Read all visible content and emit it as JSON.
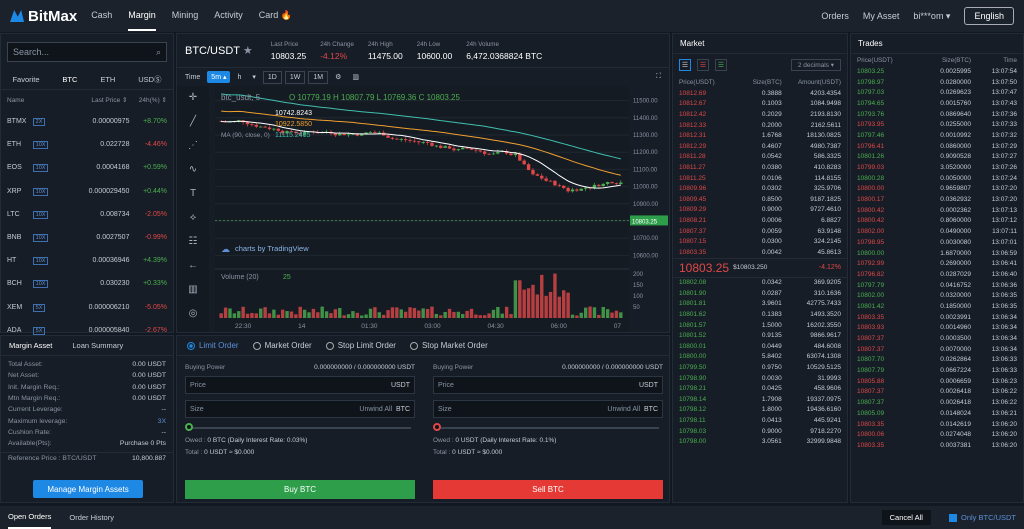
{
  "nav": {
    "brand": "BitMax",
    "links": [
      "Cash",
      "Margin",
      "Mining",
      "Activity",
      "Card"
    ],
    "orders": "Orders",
    "my_asset": "My Asset",
    "user": "bi***om ▾",
    "lang": "English"
  },
  "left": {
    "search_placeholder": "Search...",
    "tabs": [
      "Favorite",
      "BTC",
      "ETH",
      "USDⓈ"
    ],
    "head": [
      "Name",
      "Last Price ⇕",
      "24h(%) ⇕"
    ],
    "rows": [
      {
        "n": "BTMX",
        "l": "2X",
        "p": "0.00000975",
        "c": "+8.70%",
        "up": true
      },
      {
        "n": "ETH",
        "l": "10X",
        "p": "0.022728",
        "c": "-4.46%",
        "up": false
      },
      {
        "n": "EOS",
        "l": "10X",
        "p": "0.0004168",
        "c": "+0.59%",
        "up": true
      },
      {
        "n": "XRP",
        "l": "10X",
        "p": "0.000029450",
        "c": "+0.44%",
        "up": true
      },
      {
        "n": "LTC",
        "l": "10X",
        "p": "0.008734",
        "c": "-2.05%",
        "up": false
      },
      {
        "n": "BNB",
        "l": "10X",
        "p": "0.0027507",
        "c": "-0.99%",
        "up": false
      },
      {
        "n": "HT",
        "l": "10X",
        "p": "0.00036946",
        "c": "+4.39%",
        "up": true
      },
      {
        "n": "BCH",
        "l": "10X",
        "p": "0.030230",
        "c": "+0.33%",
        "up": true
      },
      {
        "n": "XEM",
        "l": "5X",
        "p": "0.000006210",
        "c": "-5.05%",
        "up": false
      },
      {
        "n": "ADA",
        "l": "5X",
        "p": "0.000005840",
        "c": "-2.67%",
        "up": false
      }
    ]
  },
  "margin": {
    "tabs": [
      "Margin Asset",
      "Loan Summary"
    ],
    "rows": [
      [
        "Total Asset:",
        "0.00 USDT"
      ],
      [
        "Net Asset:",
        "0.00 USDT"
      ],
      [
        "Init. Margin Req.:",
        "0.00 USDT"
      ],
      [
        "Mtn Margin Req.:",
        "0.00 USDT"
      ],
      [
        "Current Leverage:",
        "--"
      ],
      [
        "Maximum leverage:",
        "3X"
      ],
      [
        "Cushion Rate:",
        "--"
      ],
      [
        "Available(Pts):",
        "Purchase  0 Pts"
      ]
    ],
    "ref_label": "Reference Price : BTC/USDT",
    "ref_value": "10,800.887",
    "button": "Manage Margin Assets"
  },
  "chart": {
    "pair": "BTC/USDT",
    "stats": [
      [
        "Last Price",
        "10803.25"
      ],
      [
        "24h Change",
        "-4.12%"
      ],
      [
        "24h High",
        "11475.00"
      ],
      [
        "24h Low",
        "10600.00"
      ],
      [
        "24h Volume",
        "6,472.0368824 BTC"
      ]
    ],
    "toolbar": [
      "Time",
      "5m ▴",
      "h",
      "▾",
      "1D",
      "1W",
      "1M"
    ],
    "legend": "btc_usdt, 5",
    "ohlc": "O 10779.19  H 10807.79  L 10769.36  C 10803.25",
    "ma1": "10742.8243",
    "ma2": "10922.5850",
    "ma3": "11115.2465",
    "ma_label": "MA (90, close, 0)",
    "vol_label": "Volume (20)",
    "vol_val": "25",
    "tv": "charts by TradingView",
    "yticks": [
      "11500.00",
      "11400.00",
      "11300.00",
      "11200.00",
      "11100.00",
      "11000.00",
      "10900.00",
      "10800.00",
      "10700.00",
      "10600.00"
    ],
    "vticks": [
      "200",
      "150",
      "100",
      "50"
    ],
    "xticks": [
      "22:30",
      "14",
      "01:30",
      "03:00",
      "04:30",
      "06:00",
      "07"
    ],
    "last": "10803.25"
  },
  "form": {
    "tabs": [
      "Limit Order",
      "Market Order",
      "Stop Limit Order",
      "Stop Market Order"
    ],
    "buy": {
      "power": "0.000000000 / 0.000000000 USDT",
      "owed": "0 BTC  (Daily Interest Rate: 0.03%)",
      "total": "0 USDT ≈ $0.000",
      "btn": "Buy BTC",
      "unit": "BTC"
    },
    "sell": {
      "power": "0.000000000 / 0.000000000 USDT",
      "owed": "0 USDT  (Daily Interest Rate: 0.1%)",
      "total": "0 USDT ≈ $0.000",
      "btn": "Sell BTC",
      "unit": "BTC"
    },
    "labels": {
      "bp": "Buying Power",
      "price": "Price",
      "size": "Size",
      "unwind": "Unwind All",
      "usdt": "USDT",
      "owed": "Owed :",
      "total": "Total :"
    }
  },
  "market": {
    "title": "Market",
    "decimals": "2 decimals ▾",
    "head": [
      "Price(USDT)",
      "Size(BTC)",
      "Amount(USDT)"
    ],
    "asks": [
      [
        "10812.69",
        "0.3888",
        "4203.4354"
      ],
      [
        "10812.67",
        "0.1003",
        "1084.9498"
      ],
      [
        "10812.42",
        "0.2029",
        "2193.8130"
      ],
      [
        "10812.33",
        "0.2000",
        "2162.5611"
      ],
      [
        "10812.31",
        "1.6768",
        "18130.0825"
      ],
      [
        "10812.29",
        "0.4607",
        "4980.7387"
      ],
      [
        "10811.28",
        "0.0542",
        "586.3325"
      ],
      [
        "10811.27",
        "0.0380",
        "410.8283"
      ],
      [
        "10811.25",
        "0.0106",
        "114.8155"
      ],
      [
        "10809.96",
        "0.0302",
        "325.9706"
      ],
      [
        "10809.45",
        "0.8500",
        "9187.1825"
      ],
      [
        "10809.29",
        "0.9000",
        "9727.4610"
      ],
      [
        "10808.21",
        "0.0006",
        "6.8827"
      ],
      [
        "10807.37",
        "0.0059",
        "63.9148"
      ],
      [
        "10807.15",
        "0.0300",
        "324.2145"
      ],
      [
        "10803.35",
        "0.0042",
        "45.8613"
      ]
    ],
    "mid_price": "10803.25",
    "mid_usd": "$10803.250",
    "mid_chg": "-4.12%",
    "bids": [
      [
        "10802.08",
        "0.0342",
        "369.9205"
      ],
      [
        "10801.90",
        "0.0287",
        "310.1636"
      ],
      [
        "10801.81",
        "3.9601",
        "42775.7433"
      ],
      [
        "10801.62",
        "0.1383",
        "1493.3520"
      ],
      [
        "10801.57",
        "1.5000",
        "16202.3550"
      ],
      [
        "10801.52",
        "0.9135",
        "9866.9617"
      ],
      [
        "10800.01",
        "0.0449",
        "484.6008"
      ],
      [
        "10800.00",
        "5.8402",
        "63074.1308"
      ],
      [
        "10799.50",
        "0.9750",
        "10529.5125"
      ],
      [
        "10798.90",
        "0.0030",
        "31.9993"
      ],
      [
        "10798.21",
        "0.0425",
        "458.9606"
      ],
      [
        "10798.14",
        "1.7908",
        "19337.0975"
      ],
      [
        "10798.12",
        "1.8000",
        "19436.6160"
      ],
      [
        "10798.11",
        "0.0413",
        "445.9241"
      ],
      [
        "10798.03",
        "0.9000",
        "9718.2270"
      ],
      [
        "10798.00",
        "3.0561",
        "32999.9848"
      ]
    ]
  },
  "trades": {
    "title": "Trades",
    "head": [
      "Price(USDT)",
      "Size(BTC)",
      "Time"
    ],
    "rows": [
      [
        "10803.25",
        "0.0025995",
        "13:07:54",
        1
      ],
      [
        "10798.97",
        "0.0280000",
        "13:07:50",
        1
      ],
      [
        "10797.03",
        "0.0269623",
        "13:07:47",
        1
      ],
      [
        "10794.65",
        "0.0015760",
        "13:07:43",
        1
      ],
      [
        "10793.76",
        "0.0869640",
        "13:07:36",
        1
      ],
      [
        "10793.95",
        "0.0255000",
        "13:07:33",
        0
      ],
      [
        "10797.46",
        "0.0010992",
        "13:07:32",
        1
      ],
      [
        "10796.41",
        "0.0860000",
        "13:07:29",
        0
      ],
      [
        "10801.26",
        "0.9090528",
        "13:07:27",
        1
      ],
      [
        "10799.03",
        "3.0520000",
        "13:07:26",
        0
      ],
      [
        "10800.28",
        "0.0050000",
        "13:07:24",
        1
      ],
      [
        "10800.00",
        "0.9659807",
        "13:07:20",
        0
      ],
      [
        "10800.17",
        "0.0362932",
        "13:07:20",
        0
      ],
      [
        "10800.42",
        "0.0002362",
        "13:07:13",
        0
      ],
      [
        "10800.42",
        "0.8060000",
        "13:07:12",
        0
      ],
      [
        "10802.00",
        "0.0490000",
        "13:07:11",
        0
      ],
      [
        "10798.95",
        "0.0030080",
        "13:07:01",
        0
      ],
      [
        "10800.00",
        "1.6870000",
        "13:06:59",
        1
      ],
      [
        "10792.99",
        "0.2690000",
        "13:06:41",
        0
      ],
      [
        "10796.82",
        "0.0287029",
        "13:06:40",
        0
      ],
      [
        "10797.79",
        "0.0416752",
        "13:06:36",
        1
      ],
      [
        "10802.00",
        "0.0320000",
        "13:06:35",
        1
      ],
      [
        "10801.42",
        "0.1850000",
        "13:06:35",
        1
      ],
      [
        "10803.35",
        "0.0023991",
        "13:06:34",
        0
      ],
      [
        "10803.93",
        "0.0014960",
        "13:06:34",
        0
      ],
      [
        "10807.37",
        "0.0003500",
        "13:06:34",
        0
      ],
      [
        "10807.37",
        "0.0070000",
        "13:06:34",
        0
      ],
      [
        "10807.70",
        "0.0262864",
        "13:06:33",
        1
      ],
      [
        "10807.79",
        "0.0667224",
        "13:06:33",
        1
      ],
      [
        "10805.88",
        "0.0006659",
        "13:06:23",
        0
      ],
      [
        "10807.37",
        "0.0026418",
        "13:06:22",
        0
      ],
      [
        "10807.37",
        "0.0026418",
        "13:06:22",
        1
      ],
      [
        "10805.09",
        "0.0148024",
        "13:06:21",
        1
      ],
      [
        "10803.35",
        "0.0142619",
        "13:06:20",
        0
      ],
      [
        "10800.06",
        "0.0274048",
        "13:06:20",
        0
      ],
      [
        "10803.35",
        "0.0037381",
        "13:06:20",
        0
      ]
    ]
  },
  "bottom": {
    "tabs": [
      "Open Orders",
      "Order History"
    ],
    "cancel": "Cancel All",
    "only": "Only BTC/USDT"
  },
  "colors": {
    "up": "#4caf50",
    "down": "#e04848",
    "accent": "#1e88e5"
  }
}
